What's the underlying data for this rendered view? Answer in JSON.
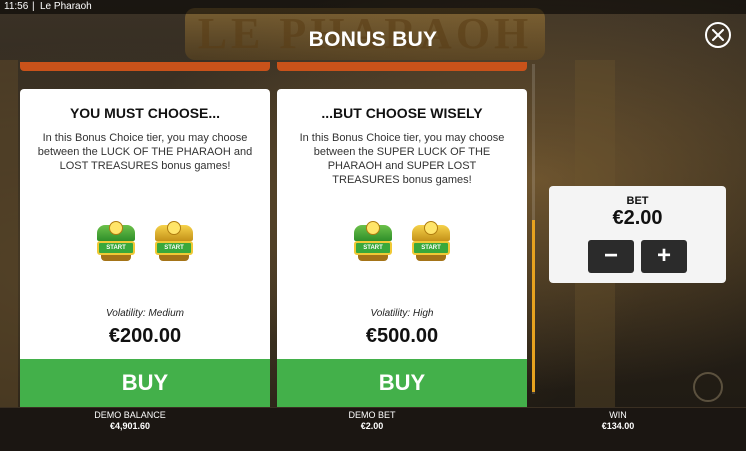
{
  "status_bar": {
    "time": "11:56",
    "separator": "|",
    "game_name": "Le Pharaoh"
  },
  "backdrop": {
    "logo_text": "LE PHARAOH"
  },
  "header": {
    "title": "BONUS BUY"
  },
  "cards": [
    {
      "title": "YOU MUST CHOOSE...",
      "description": "In this Bonus Choice tier, you may choose between the LUCK OF THE PHARAOH and LOST TREASURES bonus games!",
      "icons": [
        {
          "name": "luck-of-the-pharaoh-icon",
          "plate": "START"
        },
        {
          "name": "lost-treasures-icon",
          "plate": "START"
        }
      ],
      "volatility": "Volatility: Medium",
      "price": "€200.00",
      "buy_label": "BUY"
    },
    {
      "title": "...BUT CHOOSE WISELY",
      "description": "In this Bonus Choice tier, you may choose between the SUPER LUCK OF THE PHARAOH and SUPER LOST TREASURES bonus games!",
      "icons": [
        {
          "name": "super-luck-of-the-pharaoh-icon",
          "plate": "START"
        },
        {
          "name": "super-lost-treasures-icon",
          "plate": "START"
        }
      ],
      "volatility": "Volatility: High",
      "price": "€500.00",
      "buy_label": "BUY"
    }
  ],
  "bet": {
    "label": "BET",
    "value": "€2.00",
    "decrease": "−",
    "increase": "+"
  },
  "bottom_bar": {
    "balance_label": "DEMO BALANCE",
    "balance_value": "€4,901.60",
    "bet_label": "DEMO BET",
    "bet_value": "€2.00",
    "win_label": "WIN",
    "win_value": "€134.00"
  },
  "colors": {
    "buy_green": "#43b04a",
    "accent_orange": "#c9521a",
    "scroll_thumb": "#e6a21f"
  }
}
